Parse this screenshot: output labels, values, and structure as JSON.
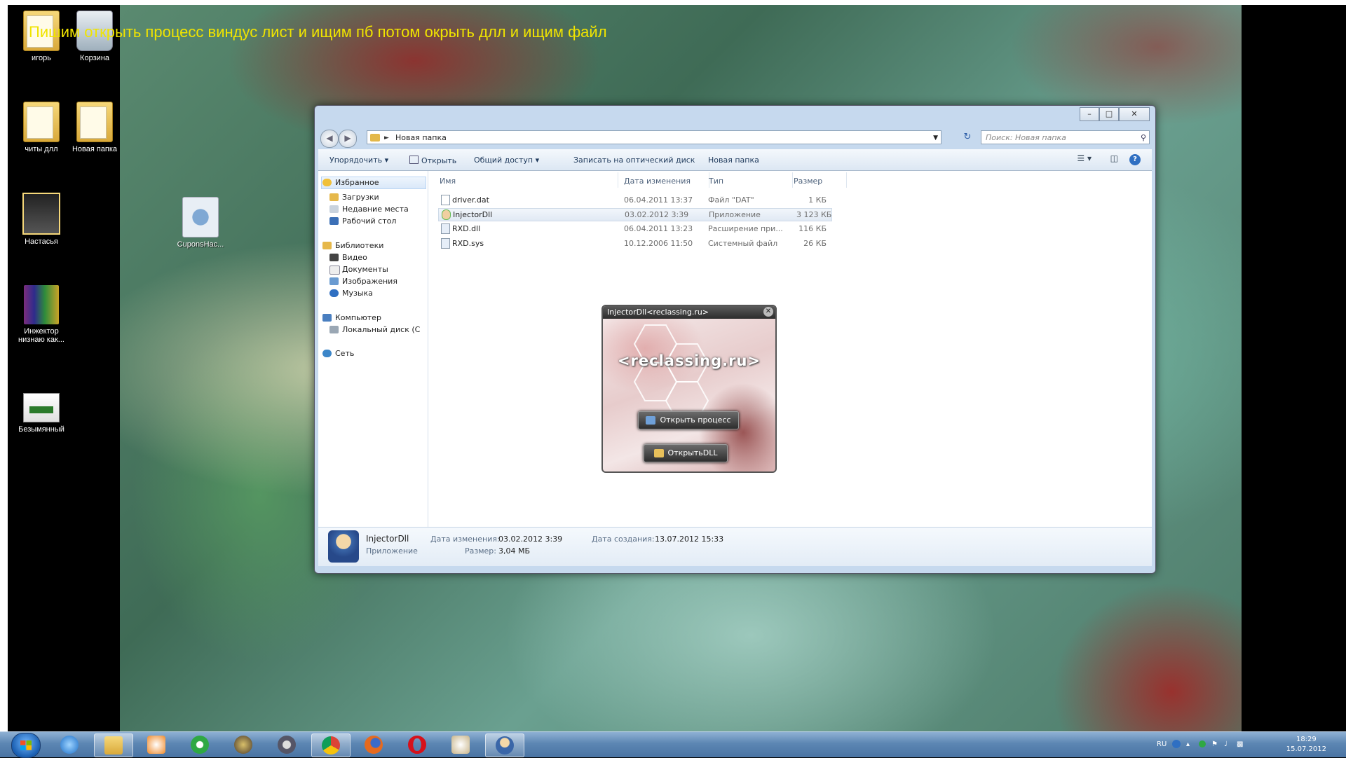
{
  "annotation_text": "Пишим открыть процесс виндус лист и ищим пб потом окрыть длл и ищим файл",
  "desktop_icons": [
    {
      "label": "игорь",
      "icon": "folder-icon"
    },
    {
      "label": "Корзина",
      "icon": "recycle-bin-icon"
    },
    {
      "label": "читы длл",
      "icon": "folder-icon"
    },
    {
      "label": "Новая папка",
      "icon": "folder-icon"
    },
    {
      "label": "Настасья",
      "icon": "photo-folder-icon"
    },
    {
      "label": "CuponsHac...",
      "icon": "config-file-icon"
    },
    {
      "label": "Инжектор низнаю как...",
      "icon": "winrar-archive-icon"
    },
    {
      "label": "Безымянный",
      "icon": "image-file-icon"
    }
  ],
  "explorer": {
    "address": "Новая папка",
    "search_placeholder": "Поиск: Новая папка",
    "toolbar": {
      "organize": "Упорядочить ▾",
      "open": "Открыть",
      "share": "Общий доступ ▾",
      "burn": "Записать на оптический диск",
      "new_folder": "Новая папка"
    },
    "nav": {
      "favorites": "Избранное",
      "downloads": "Загрузки",
      "recent": "Недавние места",
      "desktop": "Рабочий стол",
      "libraries": "Библиотеки",
      "video": "Видео",
      "documents": "Документы",
      "images": "Изображения",
      "music": "Музыка",
      "computer": "Компьютер",
      "local_disk": "Локальный диск (C",
      "network": "Сеть"
    },
    "columns": {
      "name": "Имя",
      "modified": "Дата изменения",
      "type": "Тип",
      "size": "Размер"
    },
    "files": [
      {
        "name": "driver.dat",
        "modified": "06.04.2011 13:37",
        "type": "Файл \"DAT\"",
        "size": "1 КБ"
      },
      {
        "name": "InjectorDll",
        "modified": "03.02.2012 3:39",
        "type": "Приложение",
        "size": "3 123 КБ"
      },
      {
        "name": "RXD.dll",
        "modified": "06.04.2011 13:23",
        "type": "Расширение при...",
        "size": "116 КБ"
      },
      {
        "name": "RXD.sys",
        "modified": "10.12.2006 11:50",
        "type": "Системный файл",
        "size": "26 КБ"
      }
    ],
    "details": {
      "name": "InjectorDll",
      "kind": "Приложение",
      "modified_label": "Дата изменения:",
      "modified_value": "03.02.2012 3:39",
      "size_label": "Размер:",
      "size_value": "3,04 МБ",
      "created_label": "Дата создания:",
      "created_value": "13.07.2012 15:33"
    }
  },
  "injector": {
    "title": "InjectorDll<reclassing.ru>",
    "brand": "<reclassing.ru>",
    "open_process": "Открыть процесс",
    "open_dll": "ОткрытьDLL"
  },
  "taskbar": {
    "apps": [
      "internet-explorer-icon",
      "explorer-folder-icon",
      "media-player-icon",
      "utorrent-icon",
      "app-icon",
      "settings-gear-icon",
      "chrome-icon",
      "firefox-icon",
      "opera-icon",
      "injector-doc-icon",
      "injector-app-icon"
    ],
    "lang": "RU",
    "time": "18:29",
    "date": "15.07.2012"
  },
  "colors": {
    "annotation": "#f0e400",
    "taskbar": "#5c86b3"
  }
}
